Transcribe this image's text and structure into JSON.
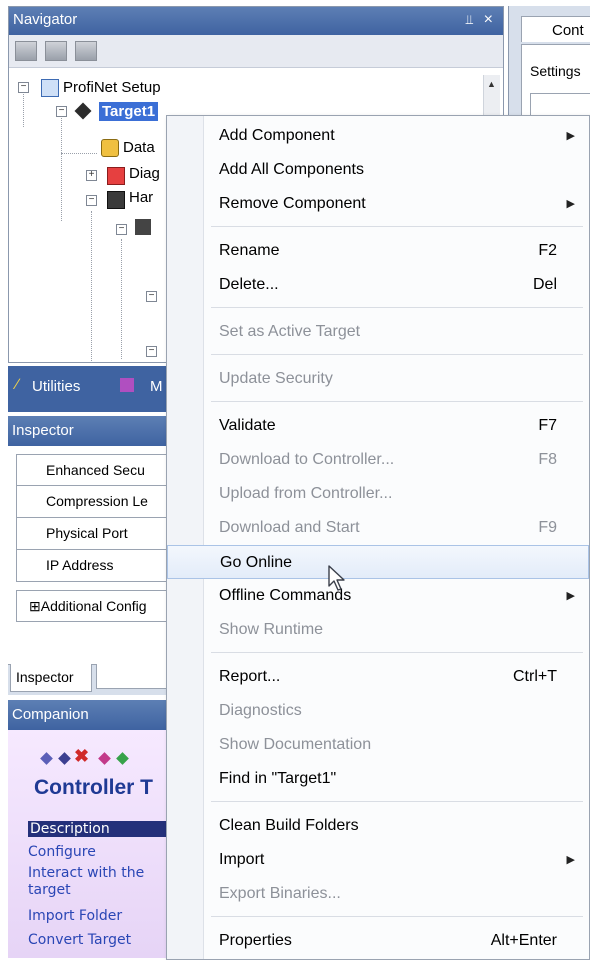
{
  "navigator": {
    "title": "Navigator",
    "pin_glyph": "#",
    "close_glyph": "×",
    "tree": [
      {
        "label": "ProfiNet Setup",
        "icon": "network-icon"
      },
      {
        "label": "Target1",
        "icon": "target-diamond-icon",
        "selected": true
      },
      {
        "label": "Data",
        "icon": "database-icon"
      },
      {
        "label": "Diag",
        "icon": "diagnostics-icon"
      },
      {
        "label": "Har",
        "icon": "hardware-icon"
      }
    ]
  },
  "right_panel": {
    "tab_label": "Cont",
    "settings_label": "Settings"
  },
  "tabs": {
    "utilities_label": "Utilities",
    "m_label": "M"
  },
  "inspector": {
    "title": "Inspector",
    "rows": [
      "Enhanced Secu",
      "Compression Le",
      "Physical Port",
      "IP Address",
      "⊞Additional Config"
    ],
    "tab_label": "Inspector"
  },
  "companion": {
    "title": "Companion",
    "heading": "Controller T",
    "links": [
      "Description",
      "Configure",
      "Interact with the",
      "target",
      "Import Folder",
      "Convert Target"
    ]
  },
  "context_menu": {
    "items": [
      {
        "label": "Add Component",
        "shortcut": "",
        "submenu": true,
        "disabled": false
      },
      {
        "label": "Add All Components",
        "shortcut": "",
        "submenu": false,
        "disabled": false
      },
      {
        "label": "Remove Component",
        "shortcut": "",
        "submenu": true,
        "disabled": false
      },
      {
        "label": "Rename",
        "shortcut": "F2",
        "submenu": false,
        "disabled": false
      },
      {
        "label": "Delete...",
        "shortcut": "Del",
        "submenu": false,
        "disabled": false
      },
      {
        "label": "Set as Active Target",
        "shortcut": "",
        "submenu": false,
        "disabled": true
      },
      {
        "label": "Update Security",
        "shortcut": "",
        "submenu": false,
        "disabled": true
      },
      {
        "label": "Validate",
        "shortcut": "F7",
        "submenu": false,
        "disabled": false
      },
      {
        "label": "Download to Controller...",
        "shortcut": "F8",
        "submenu": false,
        "disabled": true
      },
      {
        "label": "Upload from Controller...",
        "shortcut": "",
        "submenu": false,
        "disabled": true
      },
      {
        "label": "Download and Start",
        "shortcut": "F9",
        "submenu": false,
        "disabled": true
      },
      {
        "label": "Go Online",
        "shortcut": "",
        "submenu": false,
        "disabled": false,
        "hover": true
      },
      {
        "label": "Offline Commands",
        "shortcut": "",
        "submenu": true,
        "disabled": false
      },
      {
        "label": "Show Runtime",
        "shortcut": "",
        "submenu": false,
        "disabled": true
      },
      {
        "label": "Report...",
        "shortcut": "Ctrl+T",
        "submenu": false,
        "disabled": false
      },
      {
        "label": "Diagnostics",
        "shortcut": "",
        "submenu": false,
        "disabled": true
      },
      {
        "label": "Show Documentation",
        "shortcut": "",
        "submenu": false,
        "disabled": true
      },
      {
        "label": "Find in \"Target1\"",
        "shortcut": "",
        "submenu": false,
        "disabled": false
      },
      {
        "label": "Clean Build Folders",
        "shortcut": "",
        "submenu": false,
        "disabled": false
      },
      {
        "label": "Import",
        "shortcut": "",
        "submenu": true,
        "disabled": false
      },
      {
        "label": "Export Binaries...",
        "shortcut": "",
        "submenu": false,
        "disabled": true
      },
      {
        "label": "Properties",
        "shortcut": "Alt+Enter",
        "submenu": false,
        "disabled": false
      }
    ],
    "submenu_glyph": "▶"
  },
  "colors": {
    "header_blue": "#3f63a1",
    "selection_blue": "#3b6fd6",
    "link_blue": "#2a46b5",
    "disabled_gray": "#8d9199"
  }
}
